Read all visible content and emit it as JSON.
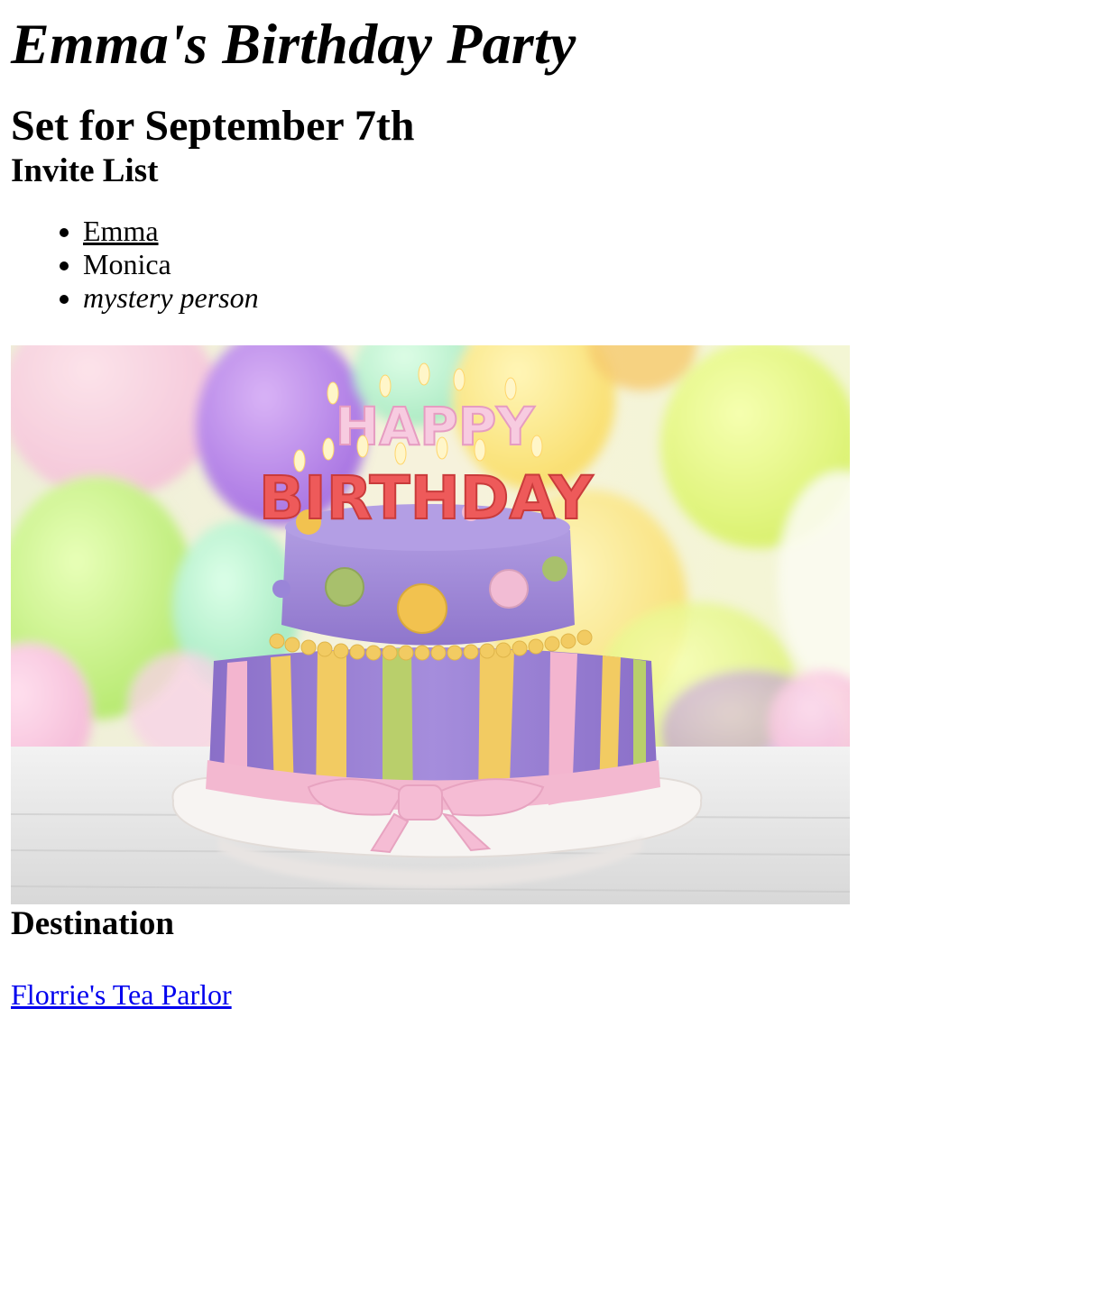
{
  "header": {
    "title": "Emma's Birthday Party",
    "subtitle": "Set for September 7th"
  },
  "invite": {
    "heading": "Invite List",
    "items": [
      "Emma",
      "Monica",
      "mystery person"
    ]
  },
  "photo": {
    "icon": "birthday-cake-photo",
    "cake_top_text": "HAPPY",
    "cake_bottom_text": "BIRTHDAY",
    "colors": {
      "cake_purple": "#9f88d6",
      "stripe_pink": "#f3b5cf",
      "stripe_yellow": "#f2cb62",
      "stripe_green": "#b9cf6b",
      "link_blue": "#0000ee"
    }
  },
  "destination": {
    "heading": "Destination",
    "link_text": "Florrie's Tea Parlor"
  }
}
